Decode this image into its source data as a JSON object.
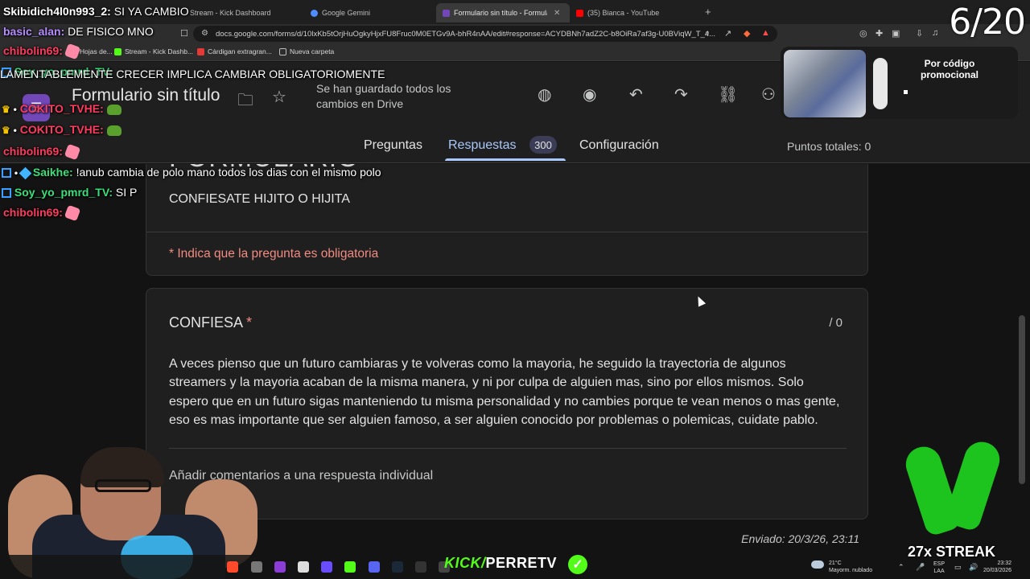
{
  "browser": {
    "tabs": [
      {
        "label": "Stream - Kick Dashboard",
        "color": "#53fc18"
      },
      {
        "label": "Google Gemini",
        "color": "#4f8cff"
      },
      {
        "label": "Formulario sin título - Formulari",
        "color": "#7248b9",
        "close": "✕"
      },
      {
        "label": "(35) Bianca - YouTube",
        "color": "#ff0000"
      }
    ],
    "new_tab": "+",
    "counter": "6/20",
    "url": "docs.google.com/forms/d/10lxKb5tOrjHuOgkyHjxFU8Fruc0M0ETGv9A-bhR4nAA/edit#response=ACYDBNh7adZ2C-b8OiRa7af3g-U0BViqW_T_4...",
    "bookmarks": [
      {
        "label": "Hojas de...",
        "color": "#1e8e3e"
      },
      {
        "label": "Stream - Kick Dashb...",
        "color": "#53fc18"
      },
      {
        "label": "Cárdigan extragran...",
        "color": "#e53935"
      },
      {
        "label": "Nueva carpeta",
        "color": "#bdbdbd"
      }
    ]
  },
  "form": {
    "title": "Formulario sin título",
    "saved_status": "Se han guardado todos los cambios en Drive",
    "tabs": {
      "questions": "Preguntas",
      "responses": "Respuestas",
      "responses_count": "300",
      "settings": "Configuración"
    },
    "total_points": "Puntos totales: 0",
    "header_text": "FORMULARIO",
    "description": "CONFIESATE HIJITO O HIJITA",
    "required_note": "* Indica que la pregunta es obligatoria",
    "question": {
      "title": "CONFIESA",
      "required_mark": "*",
      "score": "/ 0",
      "answer": "A veces pienso que un futuro cambiaras y te volveras como la mayoria, he seguido la trayectoria de algunos streamers y la mayoria acaban de la misma manera, y ni por culpa de alguien mas, sino por ellos mismos. Solo espero que en un futuro sigas manteniendo tu misma personalidad y no cambies porque te vean menos o mas gente, eso es mas importante que ser alguien famoso, a ser alguien conocido por problemas o polemicas, cuidate pablo.",
      "comment": "Añadir comentarios a una respuesta individual"
    },
    "sent": "Enviado: 20/3/26, 23:11"
  },
  "promo": {
    "text": "Por código promocional"
  },
  "chat": [
    {
      "user": "Skibidich4l0n993_2:",
      "msg": " SI YA CAMBIO"
    },
    {
      "user": "basic_alan:",
      "msg": " DE FISICO MNO"
    },
    {
      "user": "chibolin69:",
      "msg": ""
    },
    {
      "user": "Soy_yo_pmrd_TV:",
      "msg": " LAMENTABLEMENTE CRECER IMPLICA CAMBIAR OBLIGATORIOMENTE"
    },
    {
      "user": "COKITO_TVHE:",
      "msg": ""
    },
    {
      "user": "COKITO_TVHE:",
      "msg": ""
    },
    {
      "user": "chibolin69:",
      "msg": ""
    },
    {
      "user": "Saikhe:",
      "msg": " !anub cambia de polo mano todos los dias con el mismo polo"
    },
    {
      "user": "Soy_yo_pmrd_TV:",
      "msg": " SI P"
    },
    {
      "user": "chibolin69:",
      "msg": ""
    }
  ],
  "overlay": {
    "kick_brand": "KICK/",
    "channel": "PERRETV",
    "streak": "27x STREAK"
  },
  "taskbar": {
    "temp": "21°C",
    "weather": "Mayorm. nublado",
    "lang1": "ESP",
    "lang2": "LAA",
    "time": "23:32",
    "date": "20/03/2026"
  }
}
